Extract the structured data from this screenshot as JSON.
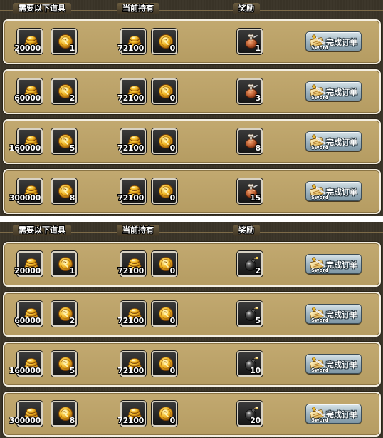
{
  "headers": {
    "need": "需要以下道具",
    "have": "当前持有",
    "reward": "奖励"
  },
  "button": {
    "label": "完成订单",
    "sub_label": "Sword"
  },
  "colors": {
    "panel_bg": "#3a3428",
    "row_bg": "#c2a970",
    "slot_bg": "#1e1e1e",
    "button_bg": "#9fb4c0"
  },
  "icons": {
    "item_1": "gold-coin-stack-icon",
    "item_2": "gold-token-icon",
    "reward_panel_0": "meat-bag-icon",
    "reward_panel_1": "bomb-icon",
    "button": "sword-scroll-icon"
  },
  "panels": [
    {
      "rows": [
        {
          "need1": "20000",
          "need2": "1",
          "have1": "72100",
          "have2": "0",
          "reward": "1"
        },
        {
          "need1": "60000",
          "need2": "2",
          "have1": "72100",
          "have2": "0",
          "reward": "3"
        },
        {
          "need1": "160000",
          "need2": "5",
          "have1": "72100",
          "have2": "0",
          "reward": "8"
        },
        {
          "need1": "300000",
          "need2": "8",
          "have1": "72100",
          "have2": "0",
          "reward": "15"
        }
      ]
    },
    {
      "rows": [
        {
          "need1": "20000",
          "need2": "1",
          "have1": "72100",
          "have2": "0",
          "reward": "2"
        },
        {
          "need1": "60000",
          "need2": "2",
          "have1": "72100",
          "have2": "0",
          "reward": "5"
        },
        {
          "need1": "160000",
          "need2": "5",
          "have1": "72100",
          "have2": "0",
          "reward": "10"
        },
        {
          "need1": "300000",
          "need2": "8",
          "have1": "72100",
          "have2": "0",
          "reward": "20"
        }
      ]
    }
  ]
}
